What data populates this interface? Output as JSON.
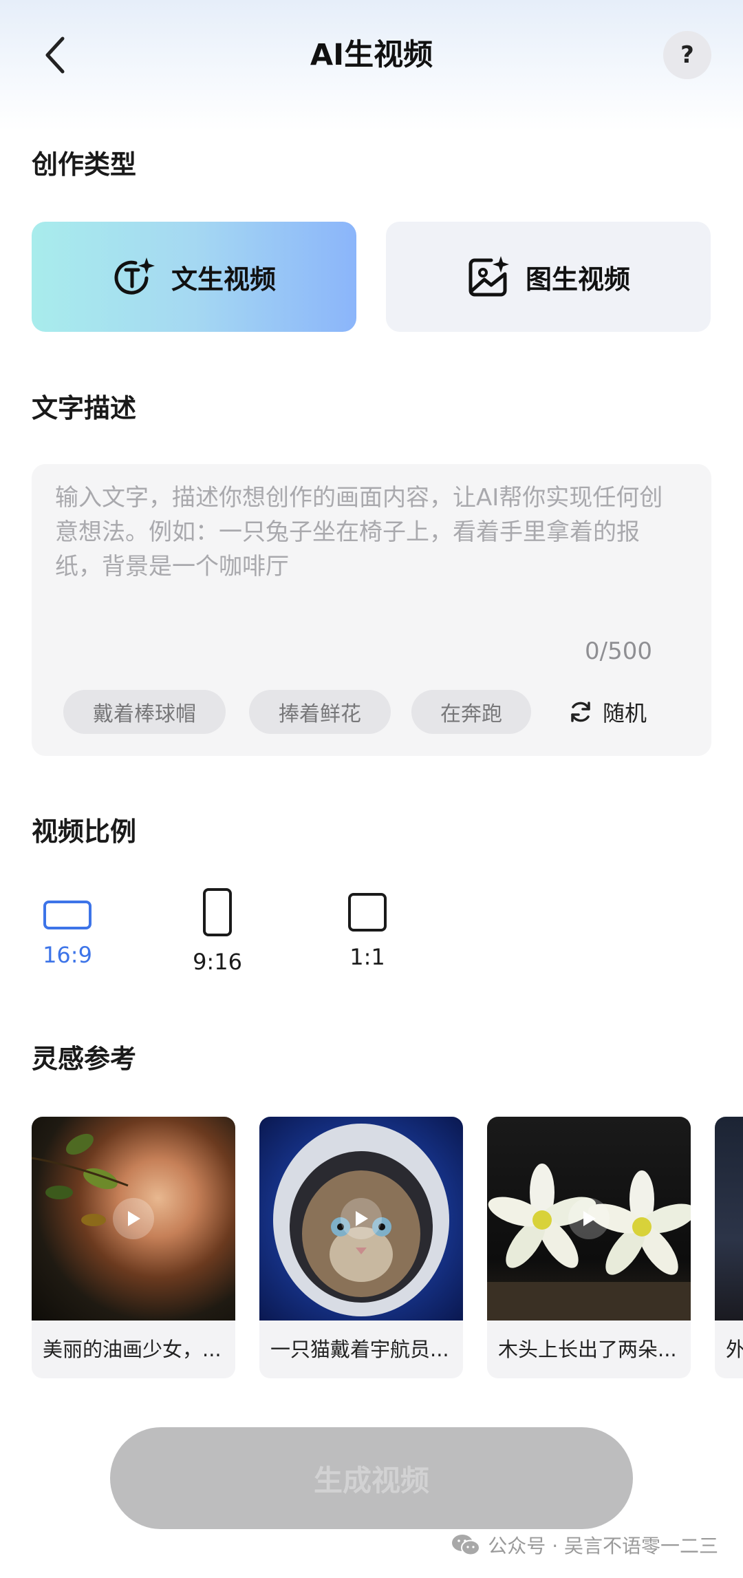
{
  "header": {
    "title": "AI生视频",
    "help_label": "?"
  },
  "creation_type": {
    "section_title": "创作类型",
    "options": [
      {
        "label": "文生视频",
        "icon": "text-sparkle-icon",
        "selected": true
      },
      {
        "label": "图生视频",
        "icon": "image-sparkle-icon",
        "selected": false
      }
    ]
  },
  "description": {
    "section_title": "文字描述",
    "placeholder": "输入文字，描述你想创作的画面内容，让AI帮你实现任何创意想法。例如：一只兔子坐在椅子上，看着手里拿着的报纸，背景是一个咖啡厅",
    "value": "",
    "counter": "0/500",
    "suggestions": [
      "戴着棒球帽",
      "捧着鲜花",
      "在奔跑"
    ],
    "random_label": "随机"
  },
  "ratio": {
    "section_title": "视频比例",
    "options": [
      {
        "label": "16:9",
        "selected": true
      },
      {
        "label": "9:16",
        "selected": false
      },
      {
        "label": "1:1",
        "selected": false
      }
    ],
    "selected_color": "#3d74e8"
  },
  "inspiration": {
    "section_title": "灵感参考",
    "items": [
      {
        "caption": "美丽的油画少女，..."
      },
      {
        "caption": "一只猫戴着宇航员..."
      },
      {
        "caption": "木头上长出了两朵..."
      },
      {
        "caption": "外"
      }
    ]
  },
  "generate_button": {
    "label": "生成视频",
    "enabled": false
  },
  "watermark": {
    "text": "公众号 · 吴言不语零一二三",
    "icon": "wechat-icon"
  }
}
